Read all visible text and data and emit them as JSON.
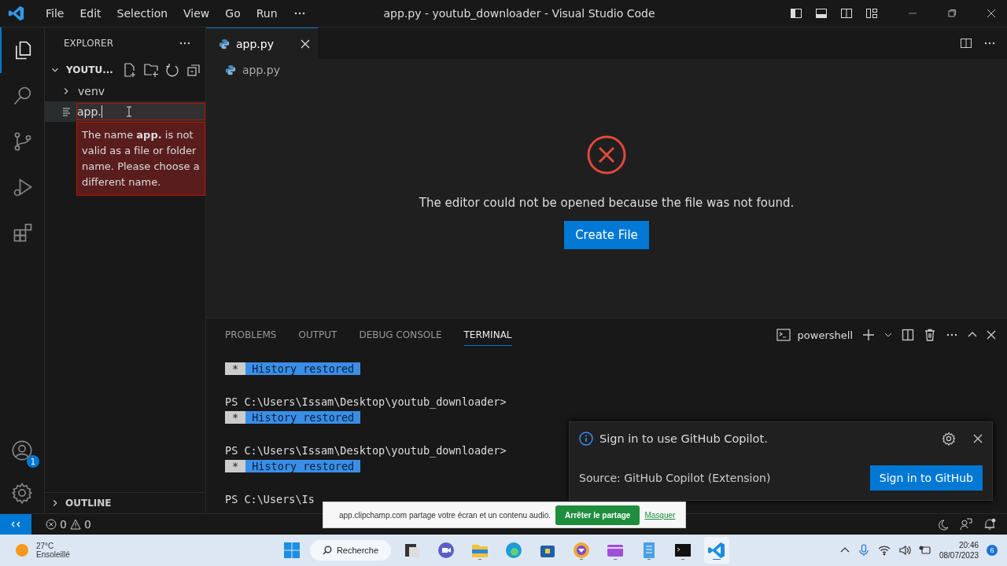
{
  "window": {
    "title": "app.py - youtub_downloader - Visual Studio Code"
  },
  "menu": [
    {
      "label": "File"
    },
    {
      "label": "Edit"
    },
    {
      "label": "Selection"
    },
    {
      "label": "View"
    },
    {
      "label": "Go"
    },
    {
      "label": "Run"
    }
  ],
  "activity_bar": [
    {
      "kind": "explorer",
      "selected": true
    },
    {
      "kind": "search",
      "selected": false
    },
    {
      "kind": "source-control",
      "selected": false
    },
    {
      "kind": "run-debug",
      "selected": false
    },
    {
      "kind": "extensions",
      "selected": false
    }
  ],
  "account_badge": "1",
  "explorer": {
    "title": "EXPLORER",
    "folder": "YOUTU...",
    "expanded": true,
    "items": [
      {
        "kind": "folder",
        "name": "venv",
        "expanded": false
      },
      {
        "kind": "rename",
        "value": "app."
      }
    ],
    "validation": "The name **app.** is not valid as a file or folder name. Please choose a different name.",
    "outline": {
      "label": "OUTLINE",
      "expanded": false
    }
  },
  "editor": {
    "tabs": [
      {
        "label": "app.py",
        "selected": true
      }
    ],
    "breadcrumb": "app.py",
    "message": "The editor could not be opened because the file was not found.",
    "button": "Create File"
  },
  "panel": {
    "tabs": [
      {
        "label": "PROBLEMS",
        "selected": false
      },
      {
        "label": "OUTPUT",
        "selected": false
      },
      {
        "label": "DEBUG CONSOLE",
        "selected": false
      },
      {
        "label": "TERMINAL",
        "selected": true
      }
    ],
    "shell": "powershell",
    "lines": [
      {
        "kind": "badge",
        "mark": "*",
        "text": "History restored"
      },
      {
        "kind": "prompt",
        "text": "PS C:\\Users\\Issam\\Desktop\\youtub_downloader>"
      },
      {
        "kind": "badge",
        "mark": "*",
        "text": "History restored"
      },
      {
        "kind": "prompt",
        "text": "PS C:\\Users\\Issam\\Desktop\\youtub_downloader>"
      },
      {
        "kind": "badge",
        "mark": "*",
        "text": "History restored"
      },
      {
        "kind": "prompt",
        "text": "PS C:\\Users\\Is"
      }
    ]
  },
  "notification": {
    "message": "Sign in to use GitHub Copilot.",
    "source": "Source: GitHub Copilot (Extension)",
    "button": "Sign in to GitHub"
  },
  "status_bar": {
    "errors": "0",
    "warnings": "0"
  },
  "share_bar": {
    "message": "app.clipchamp.com partage votre écran et un contenu audio.",
    "button": "Arrêter le partage",
    "link": "Masquer"
  },
  "taskbar": {
    "weather": {
      "temperature": "27°C",
      "condition": "Ensoleillé"
    },
    "search": "Recherche",
    "apps": [
      {
        "kind": "task-view",
        "running": false,
        "selected": false
      },
      {
        "kind": "chat",
        "running": false,
        "selected": false
      },
      {
        "kind": "files",
        "running": true,
        "selected": false
      },
      {
        "kind": "edge",
        "running": false,
        "selected": false
      },
      {
        "kind": "store",
        "running": false,
        "selected": false
      },
      {
        "kind": "browser",
        "running": true,
        "selected": false
      },
      {
        "kind": "video",
        "running": true,
        "selected": false
      },
      {
        "kind": "notepad",
        "running": true,
        "selected": false
      },
      {
        "kind": "terminal",
        "running": true,
        "selected": false
      },
      {
        "kind": "vscode",
        "running": true,
        "selected": true
      }
    ],
    "time": "20:46",
    "date": "08/07/2023",
    "notifications": "6"
  }
}
